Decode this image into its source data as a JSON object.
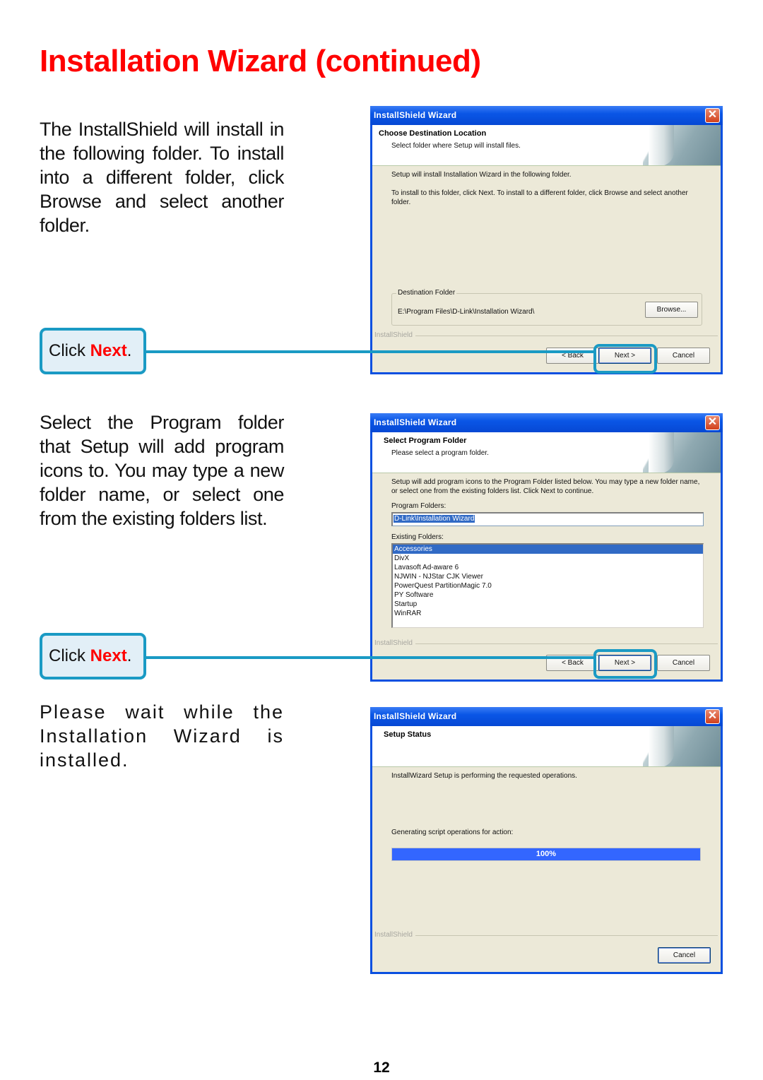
{
  "page": {
    "title": "Installation Wizard (continued)",
    "page_number": "12",
    "accent_color": "#ff0000",
    "callout_color": "#1a9ac4"
  },
  "steps": [
    {
      "description": "The InstallShield will install in the following folder. To install into a different folder, click Browse and select another folder.",
      "callout": {
        "prefix": "Click ",
        "action": "Next",
        "suffix": "."
      },
      "dialog": {
        "title": "InstallShield Wizard",
        "close_icon": "close-icon",
        "header_title": "Choose Destination Location",
        "header_subtitle": "Select folder where Setup will install files.",
        "line1": "Setup will install Installation Wizard in the following folder.",
        "line2": "To install to this folder, click Next. To install to a different folder, click Browse and select another folder.",
        "group_label": "Destination Folder",
        "destination_path": "E:\\Program Files\\D-Link\\Installation Wizard\\",
        "browse_label": "Browse...",
        "brand": "InstallShield",
        "back_label": "< Back",
        "next_label": "Next >",
        "cancel_label": "Cancel"
      }
    },
    {
      "description": "Select the Program folder that Setup will add program icons to. You may type a new folder name, or select one from the existing folders list.",
      "callout": {
        "prefix": "Click ",
        "action": "Next",
        "suffix": "."
      },
      "dialog": {
        "title": "InstallShield Wizard",
        "header_title": "Select Program Folder",
        "header_subtitle": "Please select a program folder.",
        "intro": "Setup will add program icons to the Program Folder listed below.  You may type a new folder name, or select one from the existing folders list.  Click Next to continue.",
        "program_folders_label": "Program Folders:",
        "program_folder_value": "D-Link\\Installation Wizard",
        "existing_folders_label": "Existing Folders:",
        "existing_folders": [
          "Accessories",
          "DivX",
          "Lavasoft Ad-aware 6",
          "NJWIN - NJStar CJK Viewer",
          "PowerQuest PartitionMagic 7.0",
          "PY Software",
          "Startup",
          "WinRAR"
        ],
        "selected_folder": "Accessories",
        "brand": "InstallShield",
        "back_label": "< Back",
        "next_label": "Next >",
        "cancel_label": "Cancel"
      }
    },
    {
      "description": "Please wait while the Installation Wizard is installed.",
      "dialog": {
        "title": "InstallShield Wizard",
        "header_title": "Setup Status",
        "line1": "InstallWizard Setup is performing the requested operations.",
        "line2": "Generating script operations for action:",
        "progress_percent": 100,
        "progress_label": "100%",
        "brand": "InstallShield",
        "cancel_label": "Cancel"
      }
    }
  ]
}
